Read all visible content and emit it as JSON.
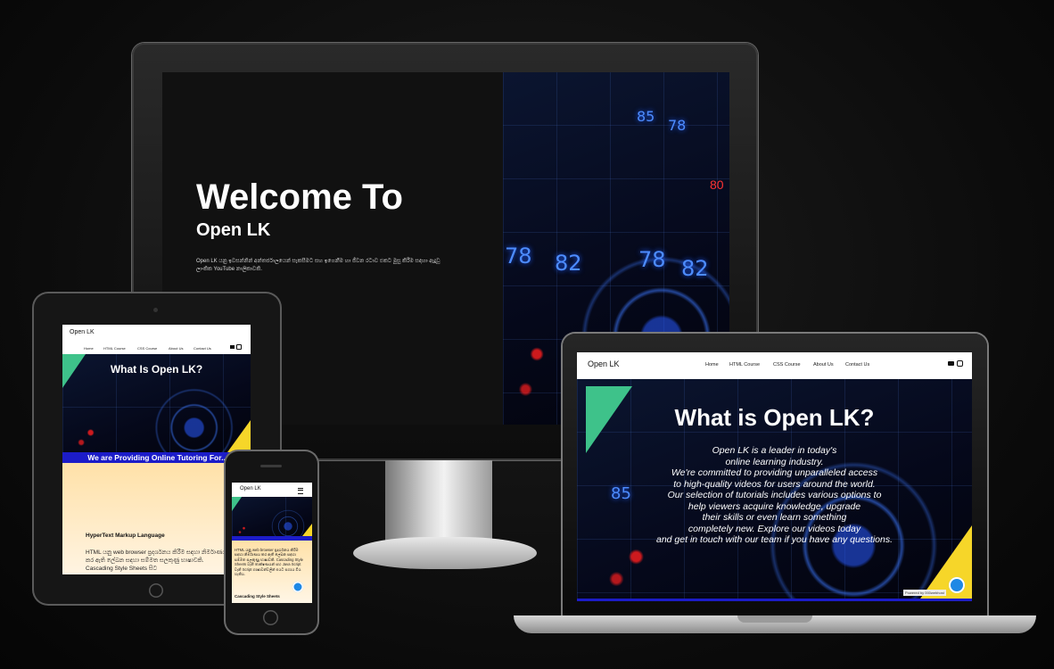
{
  "monitor": {
    "title": "Welcome To",
    "subtitle": "Open LK",
    "description": "Open LK යනු ඉවසන්නින් අන්තර්ජාලයෙන් සැකසීමට සහ ඉගෙනීම හා ජීවන රටාව එකට මුසු කිරීම සඳහා ඇදුවූ ලාංකික YouTube නාලිකාවකි.",
    "digits": [
      "78",
      "82",
      "78",
      "82",
      "85",
      "78",
      "80"
    ]
  },
  "laptop": {
    "brand": "Open LK",
    "nav": [
      "Home",
      "HTML Course",
      "CSS Course",
      "About Us",
      "Contact Us"
    ],
    "hero_title": "What is Open LK?",
    "hero_lines": [
      "Open LK is a leader in today's",
      "online learning industry.",
      "We're committed to providing unparalleled access",
      "to high-quality videos for users around the world.",
      "Our selection of tutorials includes various options to",
      "help viewers acquire knowledge, upgrade",
      "their skills or even learn something",
      "completely new. Explore our videos today",
      "and get in touch with our team if you have any questions."
    ],
    "digit": "85",
    "powered": "Powered by 000webhost"
  },
  "tablet": {
    "brand": "Open LK",
    "nav": [
      "Home",
      "HTML Course",
      "CSS Course",
      "About Us",
      "Contact Us"
    ],
    "hero_title": "What Is Open LK?",
    "banner": "We are Providing Online Tutoring For..",
    "section_title": "HyperText Markup Language",
    "section_text": "HTML යනු web browser ප්‍රදර්ශනය කිරීම සඳහා නිර්මාණය කර ඇති ලේඛන සඳහා සම්මත සලකුණු භාෂාවකි. Cascading Style Sheets සිට"
  },
  "phone": {
    "brand": "Open LK",
    "menu_icon": "hamburger-icon",
    "text": "HTML යනු web browser ප්‍රදර්ශනය කිරීම සඳහා නිර්මාණය කර ඇති ලේඛන සඳහා සම්මත සලකුණු භාෂාවකි. Cascading Style Sheets වැනි තාක්ෂණයන් සහ Java Script වැනි Script භාෂාවන්වලින් එයට සහාය විය හැකිය.",
    "footer": "Cascading Style Sheets"
  },
  "colors": {
    "accent_green": "#3ec28a",
    "accent_yellow": "#f6d629",
    "banner_blue": "#1c1cc8",
    "chat_blue": "#1e88e5"
  }
}
